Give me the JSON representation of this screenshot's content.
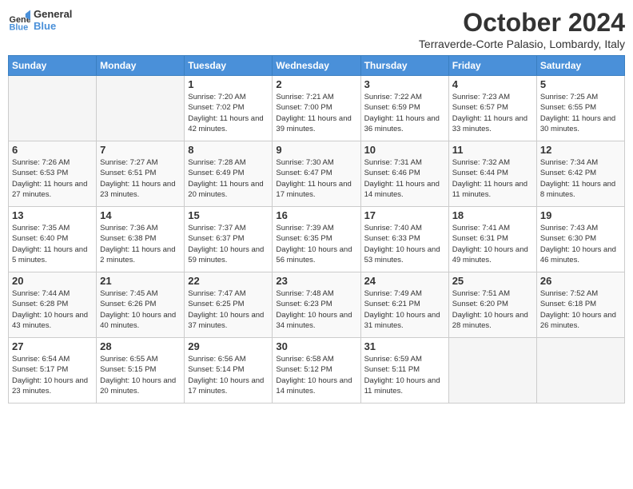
{
  "logo": {
    "text_general": "General",
    "text_blue": "Blue"
  },
  "header": {
    "month_title": "October 2024",
    "location": "Terraverde-Corte Palasio, Lombardy, Italy"
  },
  "days_of_week": [
    "Sunday",
    "Monday",
    "Tuesday",
    "Wednesday",
    "Thursday",
    "Friday",
    "Saturday"
  ],
  "weeks": [
    [
      {
        "day": "",
        "empty": true
      },
      {
        "day": "",
        "empty": true
      },
      {
        "day": "1",
        "sunrise": "Sunrise: 7:20 AM",
        "sunset": "Sunset: 7:02 PM",
        "daylight": "Daylight: 11 hours and 42 minutes."
      },
      {
        "day": "2",
        "sunrise": "Sunrise: 7:21 AM",
        "sunset": "Sunset: 7:00 PM",
        "daylight": "Daylight: 11 hours and 39 minutes."
      },
      {
        "day": "3",
        "sunrise": "Sunrise: 7:22 AM",
        "sunset": "Sunset: 6:59 PM",
        "daylight": "Daylight: 11 hours and 36 minutes."
      },
      {
        "day": "4",
        "sunrise": "Sunrise: 7:23 AM",
        "sunset": "Sunset: 6:57 PM",
        "daylight": "Daylight: 11 hours and 33 minutes."
      },
      {
        "day": "5",
        "sunrise": "Sunrise: 7:25 AM",
        "sunset": "Sunset: 6:55 PM",
        "daylight": "Daylight: 11 hours and 30 minutes."
      }
    ],
    [
      {
        "day": "6",
        "sunrise": "Sunrise: 7:26 AM",
        "sunset": "Sunset: 6:53 PM",
        "daylight": "Daylight: 11 hours and 27 minutes."
      },
      {
        "day": "7",
        "sunrise": "Sunrise: 7:27 AM",
        "sunset": "Sunset: 6:51 PM",
        "daylight": "Daylight: 11 hours and 23 minutes."
      },
      {
        "day": "8",
        "sunrise": "Sunrise: 7:28 AM",
        "sunset": "Sunset: 6:49 PM",
        "daylight": "Daylight: 11 hours and 20 minutes."
      },
      {
        "day": "9",
        "sunrise": "Sunrise: 7:30 AM",
        "sunset": "Sunset: 6:47 PM",
        "daylight": "Daylight: 11 hours and 17 minutes."
      },
      {
        "day": "10",
        "sunrise": "Sunrise: 7:31 AM",
        "sunset": "Sunset: 6:46 PM",
        "daylight": "Daylight: 11 hours and 14 minutes."
      },
      {
        "day": "11",
        "sunrise": "Sunrise: 7:32 AM",
        "sunset": "Sunset: 6:44 PM",
        "daylight": "Daylight: 11 hours and 11 minutes."
      },
      {
        "day": "12",
        "sunrise": "Sunrise: 7:34 AM",
        "sunset": "Sunset: 6:42 PM",
        "daylight": "Daylight: 11 hours and 8 minutes."
      }
    ],
    [
      {
        "day": "13",
        "sunrise": "Sunrise: 7:35 AM",
        "sunset": "Sunset: 6:40 PM",
        "daylight": "Daylight: 11 hours and 5 minutes."
      },
      {
        "day": "14",
        "sunrise": "Sunrise: 7:36 AM",
        "sunset": "Sunset: 6:38 PM",
        "daylight": "Daylight: 11 hours and 2 minutes."
      },
      {
        "day": "15",
        "sunrise": "Sunrise: 7:37 AM",
        "sunset": "Sunset: 6:37 PM",
        "daylight": "Daylight: 10 hours and 59 minutes."
      },
      {
        "day": "16",
        "sunrise": "Sunrise: 7:39 AM",
        "sunset": "Sunset: 6:35 PM",
        "daylight": "Daylight: 10 hours and 56 minutes."
      },
      {
        "day": "17",
        "sunrise": "Sunrise: 7:40 AM",
        "sunset": "Sunset: 6:33 PM",
        "daylight": "Daylight: 10 hours and 53 minutes."
      },
      {
        "day": "18",
        "sunrise": "Sunrise: 7:41 AM",
        "sunset": "Sunset: 6:31 PM",
        "daylight": "Daylight: 10 hours and 49 minutes."
      },
      {
        "day": "19",
        "sunrise": "Sunrise: 7:43 AM",
        "sunset": "Sunset: 6:30 PM",
        "daylight": "Daylight: 10 hours and 46 minutes."
      }
    ],
    [
      {
        "day": "20",
        "sunrise": "Sunrise: 7:44 AM",
        "sunset": "Sunset: 6:28 PM",
        "daylight": "Daylight: 10 hours and 43 minutes."
      },
      {
        "day": "21",
        "sunrise": "Sunrise: 7:45 AM",
        "sunset": "Sunset: 6:26 PM",
        "daylight": "Daylight: 10 hours and 40 minutes."
      },
      {
        "day": "22",
        "sunrise": "Sunrise: 7:47 AM",
        "sunset": "Sunset: 6:25 PM",
        "daylight": "Daylight: 10 hours and 37 minutes."
      },
      {
        "day": "23",
        "sunrise": "Sunrise: 7:48 AM",
        "sunset": "Sunset: 6:23 PM",
        "daylight": "Daylight: 10 hours and 34 minutes."
      },
      {
        "day": "24",
        "sunrise": "Sunrise: 7:49 AM",
        "sunset": "Sunset: 6:21 PM",
        "daylight": "Daylight: 10 hours and 31 minutes."
      },
      {
        "day": "25",
        "sunrise": "Sunrise: 7:51 AM",
        "sunset": "Sunset: 6:20 PM",
        "daylight": "Daylight: 10 hours and 28 minutes."
      },
      {
        "day": "26",
        "sunrise": "Sunrise: 7:52 AM",
        "sunset": "Sunset: 6:18 PM",
        "daylight": "Daylight: 10 hours and 26 minutes."
      }
    ],
    [
      {
        "day": "27",
        "sunrise": "Sunrise: 6:54 AM",
        "sunset": "Sunset: 5:17 PM",
        "daylight": "Daylight: 10 hours and 23 minutes."
      },
      {
        "day": "28",
        "sunrise": "Sunrise: 6:55 AM",
        "sunset": "Sunset: 5:15 PM",
        "daylight": "Daylight: 10 hours and 20 minutes."
      },
      {
        "day": "29",
        "sunrise": "Sunrise: 6:56 AM",
        "sunset": "Sunset: 5:14 PM",
        "daylight": "Daylight: 10 hours and 17 minutes."
      },
      {
        "day": "30",
        "sunrise": "Sunrise: 6:58 AM",
        "sunset": "Sunset: 5:12 PM",
        "daylight": "Daylight: 10 hours and 14 minutes."
      },
      {
        "day": "31",
        "sunrise": "Sunrise: 6:59 AM",
        "sunset": "Sunset: 5:11 PM",
        "daylight": "Daylight: 10 hours and 11 minutes."
      },
      {
        "day": "",
        "empty": true
      },
      {
        "day": "",
        "empty": true
      }
    ]
  ]
}
